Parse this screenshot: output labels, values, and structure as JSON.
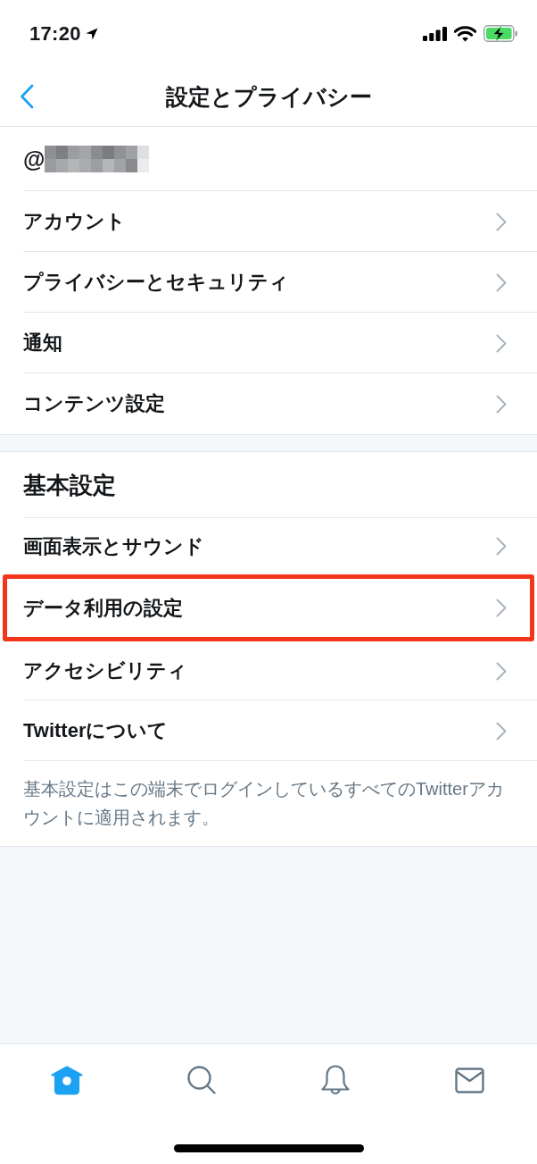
{
  "status_bar": {
    "time": "17:20"
  },
  "nav": {
    "title": "設定とプライバシー"
  },
  "sections": [
    {
      "items": [
        {
          "kind": "handle",
          "label": "@",
          "highlighted": false
        },
        {
          "kind": "link",
          "label": "アカウント",
          "highlighted": false
        },
        {
          "kind": "link",
          "label": "プライバシーとセキュリティ",
          "highlighted": false
        },
        {
          "kind": "link",
          "label": "通知",
          "highlighted": false
        },
        {
          "kind": "link",
          "label": "コンテンツ設定",
          "highlighted": false
        }
      ]
    },
    {
      "title": "基本設定",
      "items": [
        {
          "kind": "link",
          "label": "画面表示とサウンド",
          "highlighted": false
        },
        {
          "kind": "link",
          "label": "データ利用の設定",
          "highlighted": true
        },
        {
          "kind": "link",
          "label": "アクセシビリティ",
          "highlighted": false
        },
        {
          "kind": "link",
          "label": "Twitterについて",
          "highlighted": false
        }
      ],
      "note": "基本設定はこの端末でログインしているすべてのTwitterアカウントに適用されます。"
    }
  ],
  "tab_bar": [
    {
      "kind": "home",
      "selected": true
    },
    {
      "kind": "search",
      "selected": false
    },
    {
      "kind": "notifications",
      "selected": false
    },
    {
      "kind": "messages",
      "selected": false
    }
  ]
}
